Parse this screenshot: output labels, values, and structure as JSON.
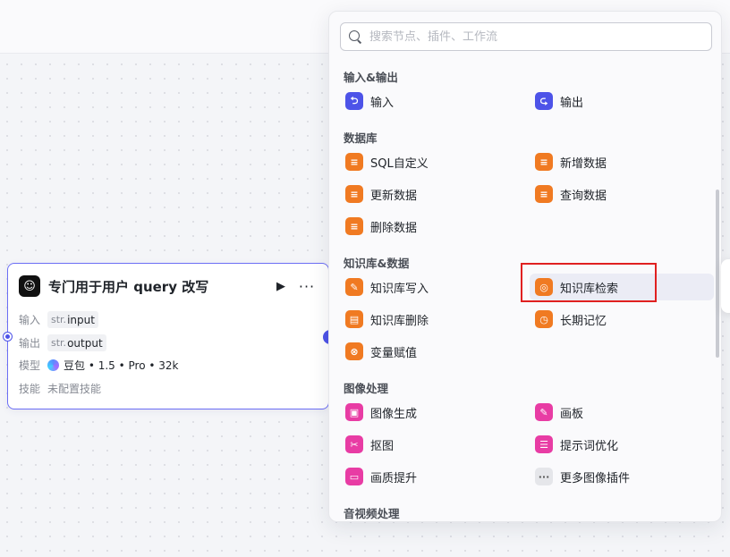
{
  "node": {
    "title": "专门用于用户 query 改写",
    "rows": {
      "input_label": "输入",
      "input_type": "str.",
      "input_name": "input",
      "output_label": "输出",
      "output_type": "str.",
      "output_name": "output",
      "model_label": "模型",
      "model_value": "豆包 • 1.5 • Pro • 32k",
      "skill_label": "技能",
      "skill_value": "未配置技能"
    }
  },
  "panel": {
    "search_placeholder": "搜索节点、插件、工作流",
    "sections": [
      {
        "title": "输入&输出",
        "items": [
          {
            "label": "输入",
            "icon": "input-icon"
          },
          {
            "label": "输出",
            "icon": "output-icon"
          }
        ]
      },
      {
        "title": "数据库",
        "items": [
          {
            "label": "SQL自定义",
            "icon": "database-icon"
          },
          {
            "label": "新增数据",
            "icon": "database-add-icon"
          },
          {
            "label": "更新数据",
            "icon": "database-update-icon"
          },
          {
            "label": "查询数据",
            "icon": "database-query-icon"
          },
          {
            "label": "删除数据",
            "icon": "database-delete-icon"
          }
        ]
      },
      {
        "title": "知识库&数据",
        "items": [
          {
            "label": "知识库写入",
            "icon": "knowledge-write-icon"
          },
          {
            "label": "知识库检索",
            "icon": "knowledge-search-icon"
          },
          {
            "label": "知识库删除",
            "icon": "knowledge-delete-icon"
          },
          {
            "label": "长期记忆",
            "icon": "memory-icon"
          },
          {
            "label": "变量赋值",
            "icon": "variable-assign-icon"
          }
        ]
      },
      {
        "title": "图像处理",
        "items": [
          {
            "label": "图像生成",
            "icon": "image-generate-icon"
          },
          {
            "label": "画板",
            "icon": "canvas-icon"
          },
          {
            "label": "抠图",
            "icon": "cutout-icon"
          },
          {
            "label": "提示词优化",
            "icon": "prompt-optimize-icon"
          },
          {
            "label": "画质提升",
            "icon": "image-enhance-icon"
          },
          {
            "label": "更多图像插件",
            "icon": "more-icon"
          }
        ]
      },
      {
        "title": "音视频处理",
        "items": []
      }
    ]
  },
  "colors": {
    "accent": "#4d53e8",
    "orange": "#f07a22",
    "pink": "#e83ca4",
    "highlight": "#e02020"
  }
}
